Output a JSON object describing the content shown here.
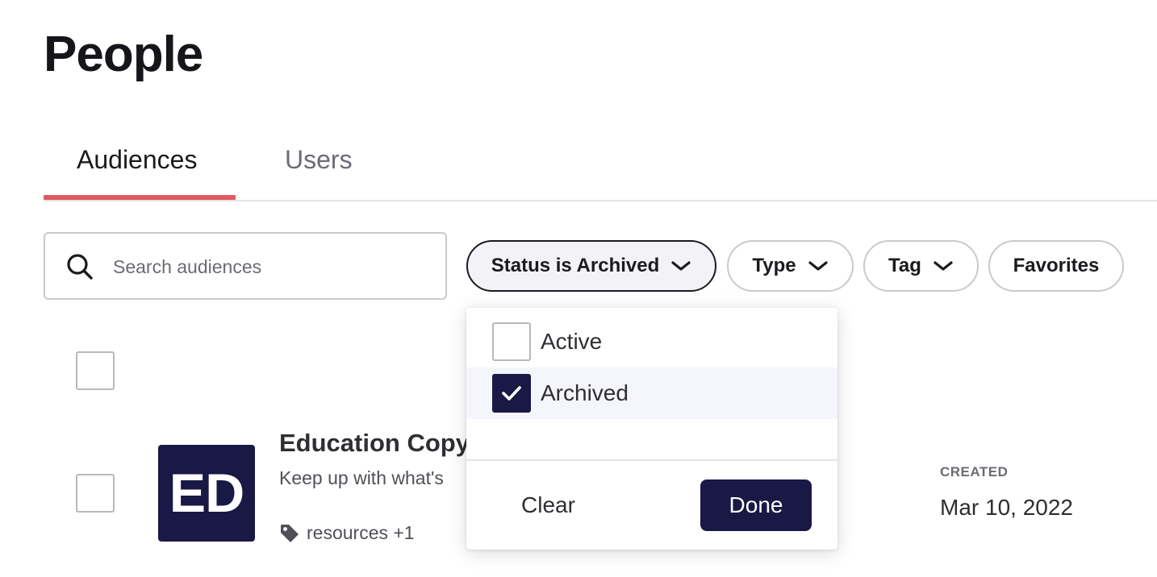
{
  "page": {
    "title": "People"
  },
  "tabs": [
    {
      "label": "Audiences",
      "active": true
    },
    {
      "label": "Users",
      "active": false
    }
  ],
  "search": {
    "placeholder": "Search audiences",
    "value": "",
    "icon": "search-icon"
  },
  "filters": [
    {
      "label": "Status is Archived",
      "icon": "chevron-down-icon",
      "active": true
    },
    {
      "label": "Type",
      "icon": "chevron-down-icon",
      "active": false
    },
    {
      "label": "Tag",
      "icon": "chevron-down-icon",
      "active": false
    },
    {
      "label": "Favorites",
      "active": false
    }
  ],
  "status_dropdown": {
    "options": [
      {
        "label": "Active",
        "checked": false
      },
      {
        "label": "Archived",
        "checked": true
      }
    ],
    "clear_label": "Clear",
    "done_label": "Done"
  },
  "audiences": [
    {
      "avatar_text": "ED",
      "title": "Education Copy",
      "description": "Keep up with what's",
      "tags_text": "resources +1",
      "created_label": "CREATED",
      "created_value": "Mar 10, 2022"
    }
  ],
  "colors": {
    "brand_navy": "#1a1845",
    "tab_accent": "#e05a5f",
    "text_primary": "#1b1b1f",
    "text_secondary": "#6b6b73"
  }
}
